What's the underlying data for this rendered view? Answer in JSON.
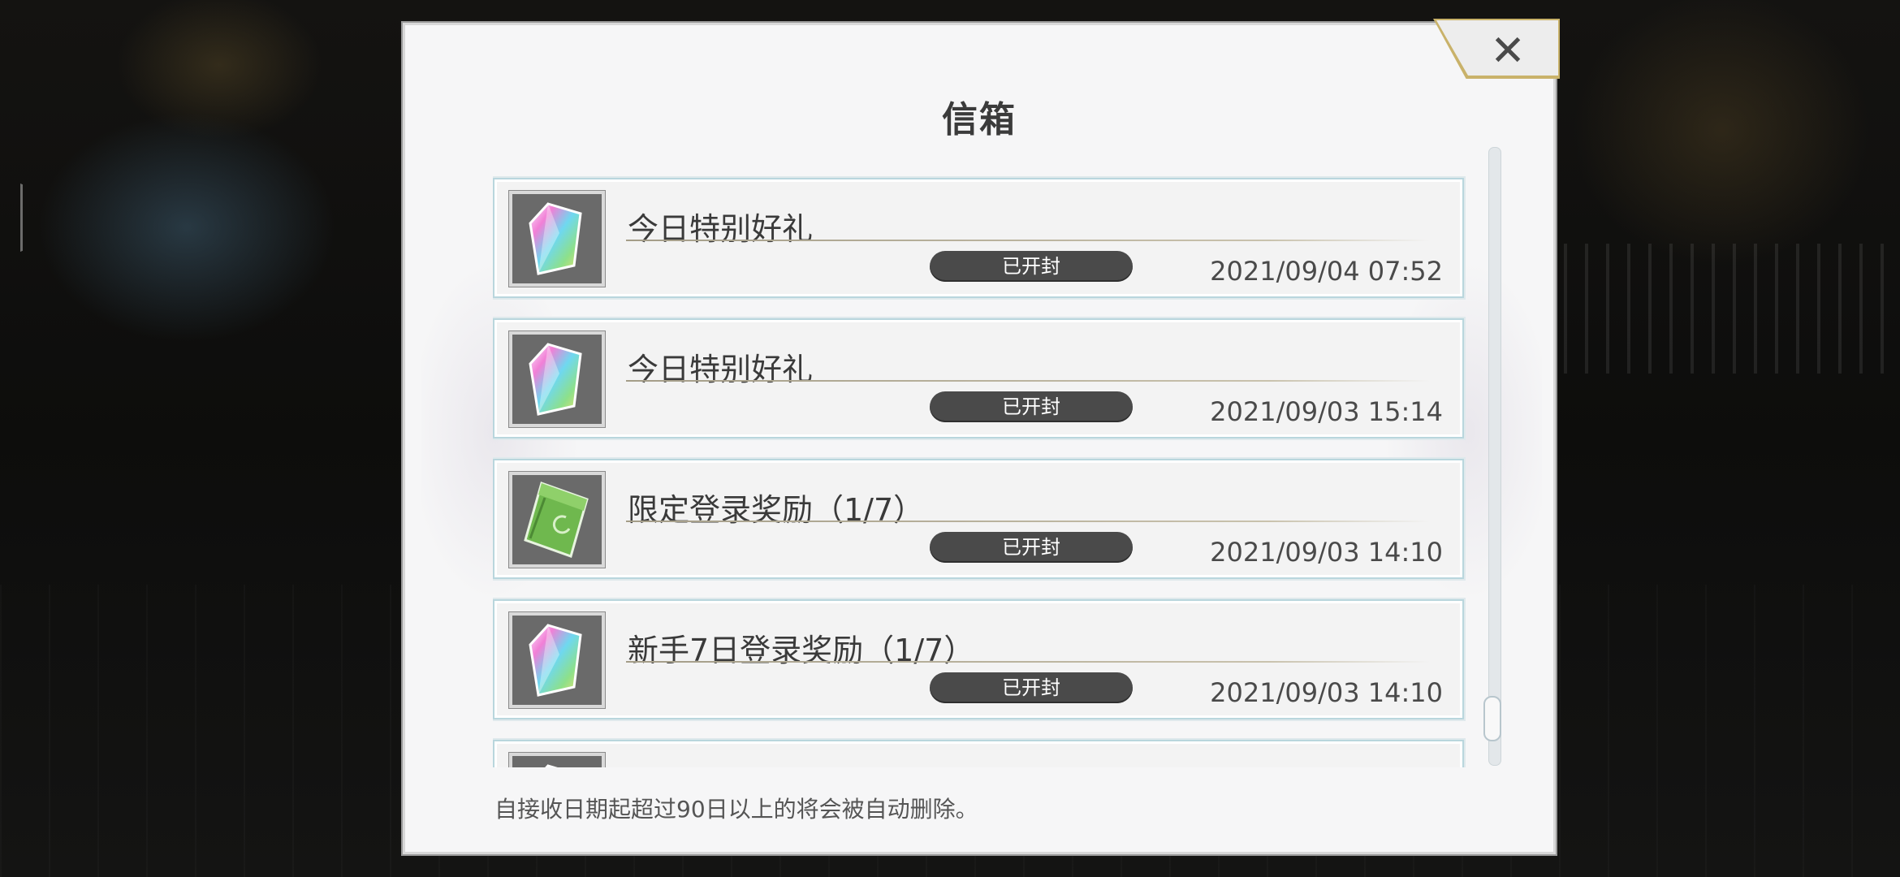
{
  "dialog": {
    "title": "信箱",
    "close_icon": "close-icon",
    "footer_note": "自接收日期起超过90日以上的将会被自动删除。"
  },
  "mails": [
    {
      "icon": "rainbow-crystal-icon",
      "title": "今日特别好礼",
      "status": "已开封",
      "date": "2021/09/04 07:52"
    },
    {
      "icon": "rainbow-crystal-icon",
      "title": "今日特别好礼",
      "status": "已开封",
      "date": "2021/09/03 15:14"
    },
    {
      "icon": "green-ticket-icon",
      "title": "限定登录奖励（1/7）",
      "status": "已开封",
      "date": "2021/09/03 14:10"
    },
    {
      "icon": "rainbow-crystal-icon",
      "title": "新手7日登录奖励（1/7）",
      "status": "已开封",
      "date": "2021/09/03 14:10"
    },
    {
      "icon": "rainbow-crystal-icon",
      "title": "",
      "status": "",
      "date": ""
    }
  ],
  "colors": {
    "dialog_bg": "#f6f6f7",
    "badge_bg": "#4a4a4a",
    "accent_gold": "#c9b26a",
    "item_border": "#b9d6dd"
  }
}
